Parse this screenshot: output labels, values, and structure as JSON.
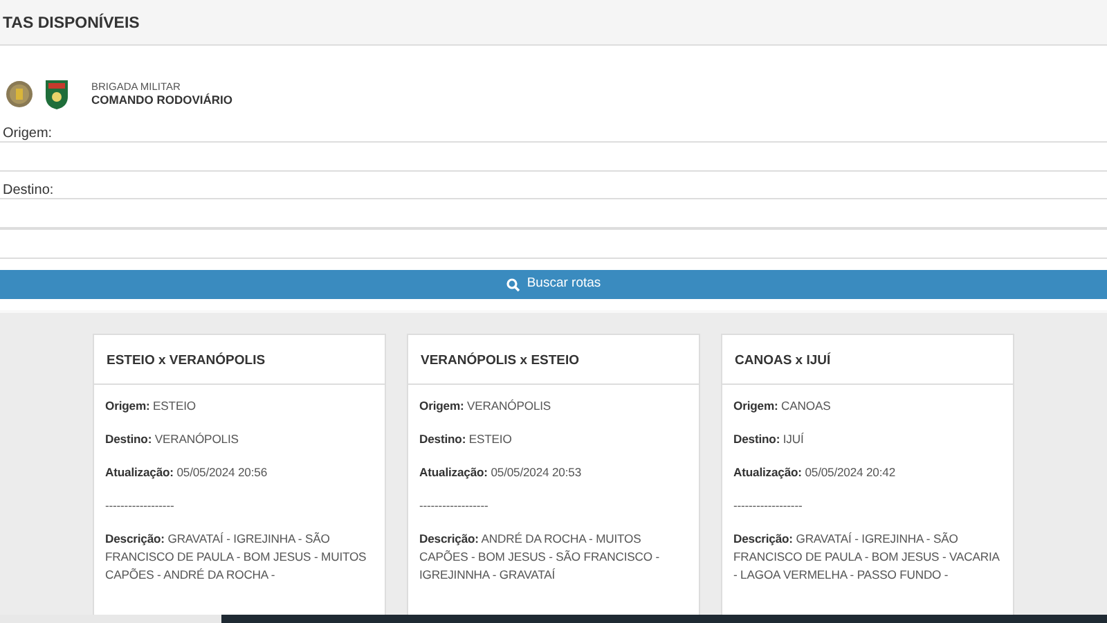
{
  "panel_title": "TAS DISPONÍVEIS",
  "logo": {
    "line_1": "BRIGADA MILITAR",
    "line_2": "COMANDO RODOVIÁRIO"
  },
  "form": {
    "fields": [
      {
        "kind": "labeled",
        "label": "Origem:"
      },
      {
        "kind": "labeled",
        "label": "Destino:"
      },
      {
        "kind": "plain"
      }
    ],
    "search_button": "Buscar rotas"
  },
  "routes": [
    {
      "title": "ESTEIO x VERANÓPOLIS",
      "rows": [
        {
          "label": "Origem:",
          "value": "ESTEIO"
        },
        {
          "label": "Destino:",
          "value": "VERANÓPOLIS"
        },
        {
          "label": "Atualização:",
          "value": "05/05/2024 20:56"
        }
      ],
      "separator": "------------------",
      "description_label": "Descrição:",
      "description": "GRAVATAÍ - IGREJINHA - SÃO FRANCISCO DE PAULA - BOM JESUS - MUITOS CAPÕES - ANDRÉ DA ROCHA -"
    },
    {
      "title": "VERANÓPOLIS x ESTEIO",
      "rows": [
        {
          "label": "Origem:",
          "value": "VERANÓPOLIS"
        },
        {
          "label": "Destino:",
          "value": "ESTEIO"
        },
        {
          "label": "Atualização:",
          "value": "05/05/2024 20:53"
        }
      ],
      "separator": "------------------",
      "description_label": "Descrição:",
      "description": "ANDRÉ DA ROCHA - MUITOS CAPÕES - BOM JESUS - SÃO FRANCISCO - IGREJINNHA - GRAVATAÍ"
    },
    {
      "title": "CANOAS x IJUÍ",
      "rows": [
        {
          "label": "Origem:",
          "value": "CANOAS"
        },
        {
          "label": "Destino:",
          "value": "IJUÍ"
        },
        {
          "label": "Atualização:",
          "value": "05/05/2024 20:42"
        }
      ],
      "separator": "------------------",
      "description_label": "Descrição:",
      "description": "GRAVATAÍ - IGREJINHA - SÃO FRANCISCO DE PAULA - BOM JESUS - VACARIA - LAGOA VERMELHA - PASSO FUNDO -"
    }
  ]
}
